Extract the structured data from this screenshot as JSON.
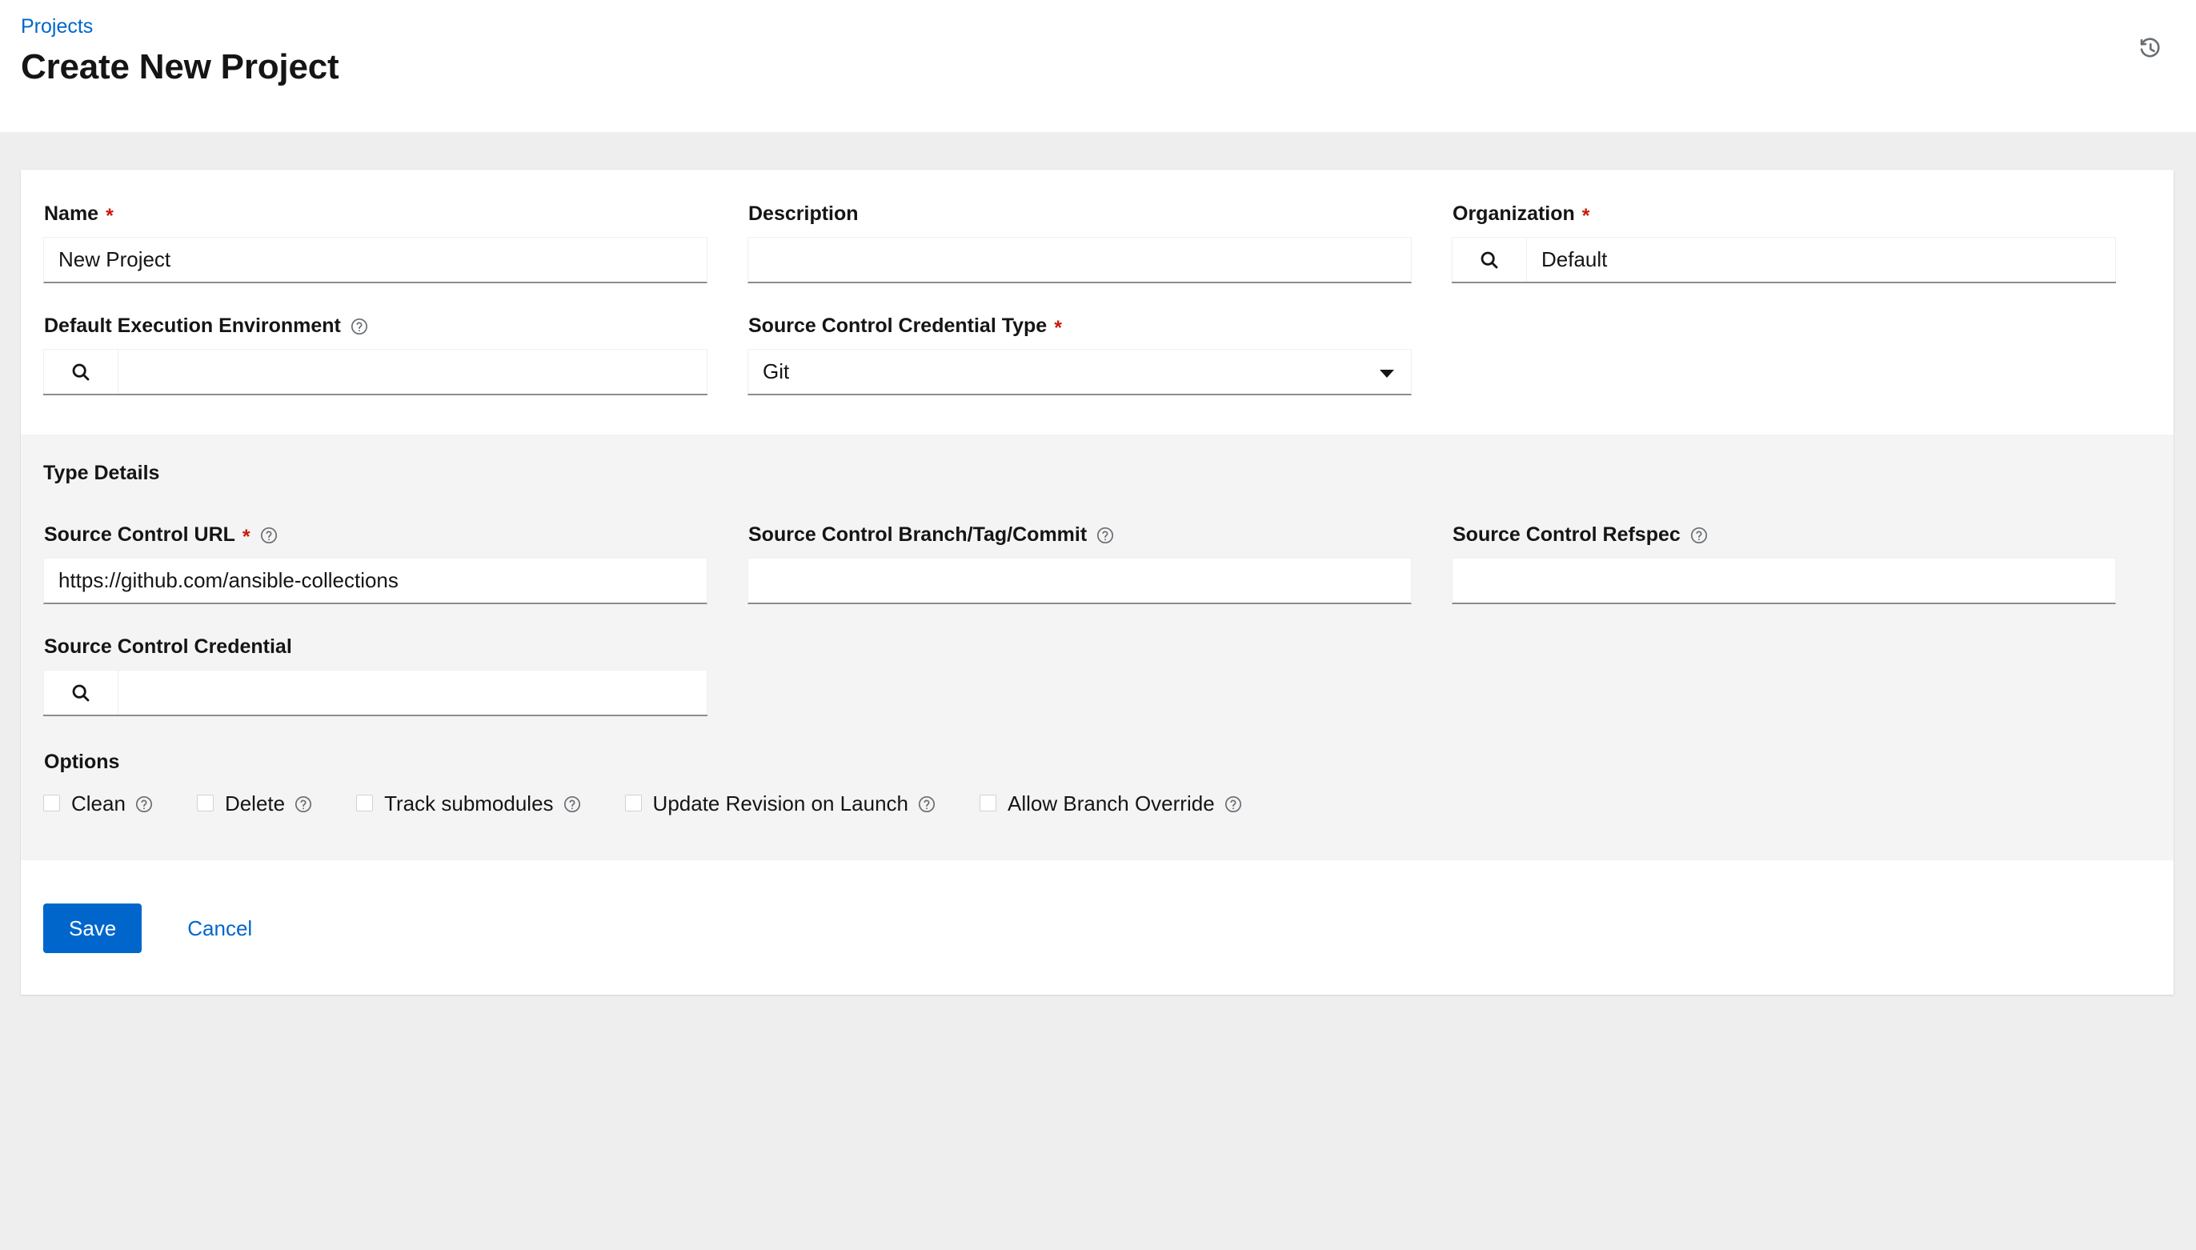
{
  "header": {
    "breadcrumb": "Projects",
    "title": "Create New Project",
    "history_icon": "history-icon"
  },
  "colors": {
    "accent": "#0066CC",
    "required": "#C9190B",
    "page_background": "#EEEEEE",
    "section_background": "#F4F4F4",
    "text": "#151515"
  },
  "basic_section": {
    "name": {
      "label": "Name",
      "required": true,
      "value": "New Project",
      "placeholder": ""
    },
    "description": {
      "label": "Description",
      "required": false,
      "value": "",
      "placeholder": ""
    },
    "organization": {
      "label": "Organization",
      "required": true,
      "value": "Default",
      "placeholder": "",
      "icon": "search-icon"
    },
    "execution_environment": {
      "label": "Default Execution Environment",
      "required": false,
      "value": "",
      "placeholder": "",
      "icon": "search-icon",
      "help_icon": "help-circle-icon"
    },
    "credential_type": {
      "label": "Source Control Credential Type",
      "required": true,
      "value": "Git",
      "options": [
        "Git"
      ],
      "icon": "chevron-down-icon"
    }
  },
  "type_details": {
    "heading": "Type Details",
    "source_control_url": {
      "label": "Source Control URL",
      "required": true,
      "value": "https://github.com/ansible-collections",
      "placeholder": "",
      "help_icon": "help-circle-icon"
    },
    "branch_tag_commit": {
      "label": "Source Control Branch/Tag/Commit",
      "required": false,
      "value": "",
      "placeholder": "",
      "help_icon": "help-circle-icon"
    },
    "refspec": {
      "label": "Source Control Refspec",
      "required": false,
      "value": "",
      "placeholder": "",
      "help_icon": "help-circle-icon"
    },
    "source_control_credential": {
      "label": "Source Control Credential",
      "required": false,
      "value": "",
      "placeholder": "",
      "icon": "search-icon"
    },
    "options": {
      "label": "Options",
      "items": [
        {
          "label": "Clean",
          "checked": false,
          "help_icon": "help-circle-icon"
        },
        {
          "label": "Delete",
          "checked": false,
          "help_icon": "help-circle-icon"
        },
        {
          "label": "Track submodules",
          "checked": false,
          "help_icon": "help-circle-icon"
        },
        {
          "label": "Update Revision on Launch",
          "checked": false,
          "help_icon": "help-circle-icon"
        },
        {
          "label": "Allow Branch Override",
          "checked": false,
          "help_icon": "help-circle-icon"
        }
      ]
    }
  },
  "footer": {
    "save_label": "Save",
    "cancel_label": "Cancel"
  }
}
